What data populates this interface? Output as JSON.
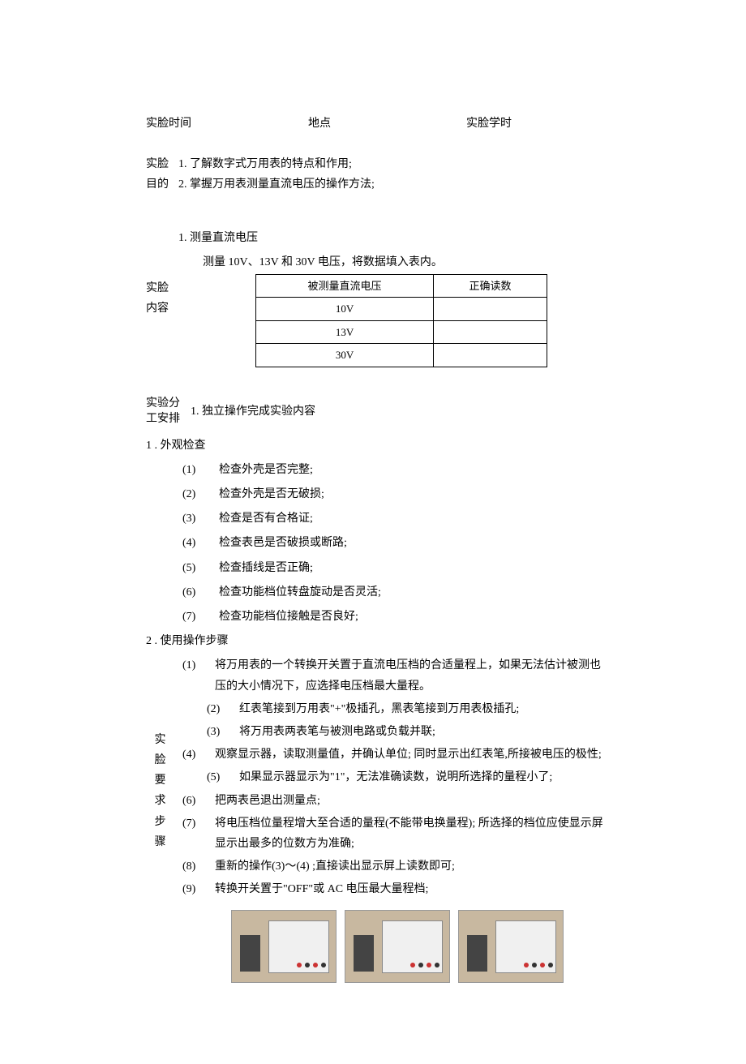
{
  "header": {
    "time_label": "实脸时间",
    "place_label": "地点",
    "hours_label": "实脸学时"
  },
  "purpose": {
    "label_prefix1": "实脸",
    "label_prefix2": "目的",
    "line1": "1. 了解数字式万用表的特点和作用;",
    "line2": "2. 掌握万用表测量直流电压的操作方法;"
  },
  "measure": {
    "heading": "1. 测量直流电压",
    "desc": "测量 10V、13V 和 30V 电压，将数据填入表内。"
  },
  "content_label1": "实脸",
  "content_label2": "内容",
  "table": {
    "col1": "被测量直流电压",
    "col2": "正确读数",
    "rows": [
      "10V",
      "13V",
      "30V"
    ]
  },
  "arrange": {
    "label": "实验分工安排",
    "text": "1. 独立操作完成实验内容"
  },
  "section1": {
    "title": "1 . 外观检查",
    "items": [
      "检查外壳是否完整;",
      "检查外壳是否无破损;",
      "检查是否有合格证;",
      "检查表邑是否破损或断路;",
      "检查插线是否正确;",
      "检查功能档位转盘旋动是否灵活;",
      "检查功能档位接触是否良好;"
    ]
  },
  "section2": {
    "title": "2 . 使用操作步骤",
    "sidelabel": [
      "实",
      "脸",
      "要",
      "求",
      "步",
      "骤"
    ],
    "steps": [
      {
        "n": "(1)",
        "t": "将万用表的一个转换开关置于直流电压档的合适量程上，如果无法估计被测也压的大小情况下，应选择电压档最大量程。",
        "indent": 0
      },
      {
        "n": "(2)",
        "t": "红表笔接到万用表\"+\"极插孔，黑表笔接到万用表极插孔;",
        "indent": 1
      },
      {
        "n": "(3)",
        "t": "将万用表两表笔与被测电路或负载并联;",
        "indent": 1
      },
      {
        "n": "(4)",
        "t": "观察显示器，读取测量值，并确认单位; 同时显示出红表笔,所接被电压的极性;",
        "indent": 0
      },
      {
        "n": "(5)",
        "t": "如果显示器显示为\"1\"，无法准确读数，说明所选择的量程小了;",
        "indent": 1
      },
      {
        "n": "(6)",
        "t": "把两表邑退出测量点;",
        "indent": 0
      },
      {
        "n": "(7)",
        "t": "将电压档位量程增大至合适的量程(不能带电换量程); 所选择的档位应使显示屏显示出最多的位数方为准确;",
        "indent": 0
      },
      {
        "n": "(8)",
        "t": "重新的操作(3)～(4) ;直接读出显示屏上读数即可;",
        "indent": 0
      },
      {
        "n": "(9)",
        "t": "转换开关置于\"OFF\"或 AC 电压最大量程档;",
        "indent": 0
      }
    ]
  }
}
